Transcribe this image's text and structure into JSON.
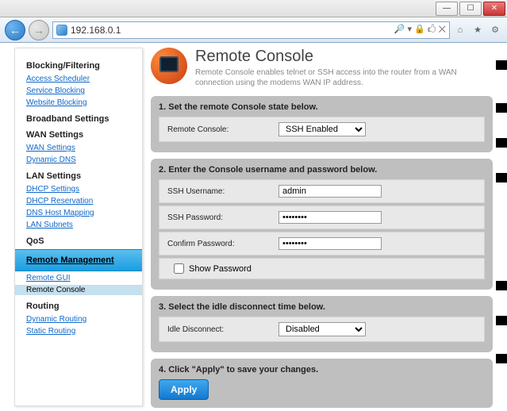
{
  "browser": {
    "url": "192.168.0.1"
  },
  "sidebar": {
    "sections": [
      {
        "title": "Blocking/Filtering",
        "links": [
          "Access Scheduler",
          "Service Blocking",
          "Website Blocking"
        ]
      },
      {
        "title": "Broadband Settings",
        "links": []
      },
      {
        "title": "WAN Settings",
        "links": [
          "WAN Settings",
          "Dynamic DNS"
        ]
      },
      {
        "title": "LAN Settings",
        "links": [
          "DHCP Settings",
          "DHCP Reservation",
          "DNS Host Mapping",
          "LAN Subnets"
        ]
      },
      {
        "title": "QoS",
        "links": []
      }
    ],
    "active": {
      "title": "Remote Management",
      "links": [
        "Remote GUI",
        "Remote Console"
      ],
      "current": "Remote Console"
    },
    "after": [
      {
        "title": "Routing",
        "links": [
          "Dynamic Routing",
          "Static Routing"
        ]
      }
    ]
  },
  "page": {
    "title": "Remote Console",
    "subtitle": "Remote Console enables telnet or SSH access into the router from a WAN connection using the modems WAN IP address.",
    "step1": {
      "title": "1. Set the remote Console state below.",
      "label": "Remote Console:",
      "value": "SSH Enabled"
    },
    "step2": {
      "title": "2. Enter the Console username and password below.",
      "user_label": "SSH Username:",
      "user_value": "admin",
      "pass_label": "SSH Password:",
      "pass_value": "••••••••",
      "conf_label": "Confirm Password:",
      "conf_value": "••••••••",
      "show_label": "Show Password"
    },
    "step3": {
      "title": "3. Select the idle disconnect time below.",
      "label": "Idle Disconnect:",
      "value": "Disabled"
    },
    "step4": {
      "title": "4. Click \"Apply\" to save your changes.",
      "button": "Apply"
    }
  }
}
